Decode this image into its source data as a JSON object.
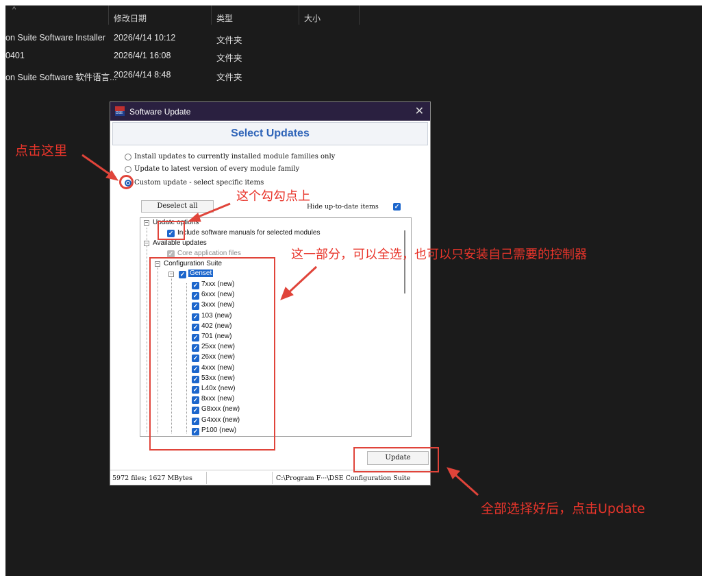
{
  "explorer": {
    "headers": {
      "date": "修改日期",
      "type": "类型",
      "size": "大小"
    },
    "rows": [
      {
        "name": "on Suite Software Installer",
        "date": "2026/4/14 10:12",
        "type": "文件夹"
      },
      {
        "name": "0401",
        "date": "2026/4/1 16:08",
        "type": "文件夹"
      },
      {
        "name": "on Suite Software 软件语言...",
        "date": "2026/4/14 8:48",
        "type": "文件夹"
      }
    ]
  },
  "dialog": {
    "title": "Software Update",
    "icon_label": "DSE",
    "banner": "Select Updates",
    "options": [
      {
        "label": "Install updates to currently installed module families only",
        "selected": false
      },
      {
        "label": "Update to latest version of every module family",
        "selected": false
      },
      {
        "label": "Custom update - select specific items",
        "selected": true
      }
    ],
    "deselect_label": "Deselect all",
    "hide_label": "Hide up-to-date items",
    "tree": {
      "update_options": "Update options",
      "include_manuals": "Include software manuals for selected modules",
      "available_updates": "Available updates",
      "core_files": "Core application files",
      "config_suite": "Configuration Suite",
      "genset": "Genset",
      "items": [
        "7xxx (new)",
        "6xxx (new)",
        "3xxx (new)",
        "103 (new)",
        "402 (new)",
        "701 (new)",
        "25xx (new)",
        "26xx (new)",
        "4xxx (new)",
        "53xx (new)",
        "L40x (new)",
        "8xxx (new)",
        "G8xxx (new)",
        "G4xxx (new)",
        "P100 (new)"
      ]
    },
    "update_label": "Update",
    "status_left": "5972 files; 1627 MBytes",
    "status_right": "C:\\Program F···\\DSE Configuration Suite"
  },
  "annotations": {
    "click_here": "点击这里",
    "tick_this": "这个勾勾点上",
    "this_part": "这一部分，可以全选，也可以只安装自己需要的控制器",
    "after_select": "全部选择好后，点击Update"
  }
}
